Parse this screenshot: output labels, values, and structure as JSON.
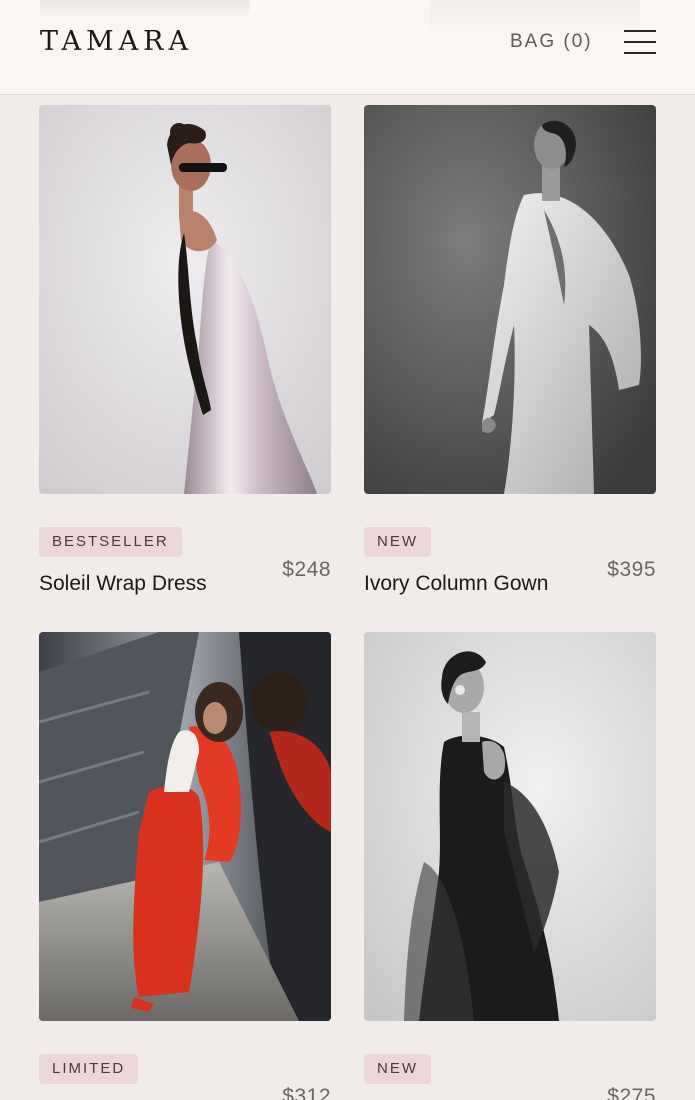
{
  "header": {
    "logo": "TAMARA",
    "bag_label": "BAG (0)"
  },
  "products": [
    {
      "badge": "BESTSELLER",
      "name": "Soleil Wrap Dress",
      "price": "$248",
      "image": "model in satin blush strapless gown with sunglasses and black opera glove"
    },
    {
      "badge": "NEW",
      "name": "Ivory Column Gown",
      "price": "$395",
      "image": "model in white tailored suit, monochrome"
    },
    {
      "badge": "LIMITED",
      "name": "",
      "price": "$312",
      "image": "model in red suit leaning against reflective wall"
    },
    {
      "badge": "NEW",
      "name": "",
      "price": "$275",
      "image": "model in black sheer tulle gown, monochrome"
    }
  ],
  "colors": {
    "background": "#f1ebe9",
    "header": "#f9f6f4",
    "badge": "#ecd6da",
    "accent_red": "#d8321f"
  }
}
